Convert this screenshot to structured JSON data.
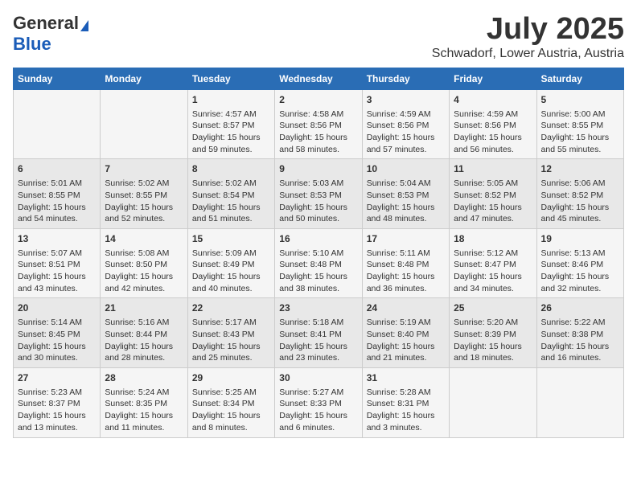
{
  "logo": {
    "general": "General",
    "blue": "Blue"
  },
  "title": {
    "month": "July 2025",
    "location": "Schwadorf, Lower Austria, Austria"
  },
  "weekdays": [
    "Sunday",
    "Monday",
    "Tuesday",
    "Wednesday",
    "Thursday",
    "Friday",
    "Saturday"
  ],
  "weeks": [
    [
      {
        "day": "",
        "info": ""
      },
      {
        "day": "",
        "info": ""
      },
      {
        "day": "1",
        "info": "Sunrise: 4:57 AM\nSunset: 8:57 PM\nDaylight: 15 hours\nand 59 minutes."
      },
      {
        "day": "2",
        "info": "Sunrise: 4:58 AM\nSunset: 8:56 PM\nDaylight: 15 hours\nand 58 minutes."
      },
      {
        "day": "3",
        "info": "Sunrise: 4:59 AM\nSunset: 8:56 PM\nDaylight: 15 hours\nand 57 minutes."
      },
      {
        "day": "4",
        "info": "Sunrise: 4:59 AM\nSunset: 8:56 PM\nDaylight: 15 hours\nand 56 minutes."
      },
      {
        "day": "5",
        "info": "Sunrise: 5:00 AM\nSunset: 8:55 PM\nDaylight: 15 hours\nand 55 minutes."
      }
    ],
    [
      {
        "day": "6",
        "info": "Sunrise: 5:01 AM\nSunset: 8:55 PM\nDaylight: 15 hours\nand 54 minutes."
      },
      {
        "day": "7",
        "info": "Sunrise: 5:02 AM\nSunset: 8:55 PM\nDaylight: 15 hours\nand 52 minutes."
      },
      {
        "day": "8",
        "info": "Sunrise: 5:02 AM\nSunset: 8:54 PM\nDaylight: 15 hours\nand 51 minutes."
      },
      {
        "day": "9",
        "info": "Sunrise: 5:03 AM\nSunset: 8:53 PM\nDaylight: 15 hours\nand 50 minutes."
      },
      {
        "day": "10",
        "info": "Sunrise: 5:04 AM\nSunset: 8:53 PM\nDaylight: 15 hours\nand 48 minutes."
      },
      {
        "day": "11",
        "info": "Sunrise: 5:05 AM\nSunset: 8:52 PM\nDaylight: 15 hours\nand 47 minutes."
      },
      {
        "day": "12",
        "info": "Sunrise: 5:06 AM\nSunset: 8:52 PM\nDaylight: 15 hours\nand 45 minutes."
      }
    ],
    [
      {
        "day": "13",
        "info": "Sunrise: 5:07 AM\nSunset: 8:51 PM\nDaylight: 15 hours\nand 43 minutes."
      },
      {
        "day": "14",
        "info": "Sunrise: 5:08 AM\nSunset: 8:50 PM\nDaylight: 15 hours\nand 42 minutes."
      },
      {
        "day": "15",
        "info": "Sunrise: 5:09 AM\nSunset: 8:49 PM\nDaylight: 15 hours\nand 40 minutes."
      },
      {
        "day": "16",
        "info": "Sunrise: 5:10 AM\nSunset: 8:48 PM\nDaylight: 15 hours\nand 38 minutes."
      },
      {
        "day": "17",
        "info": "Sunrise: 5:11 AM\nSunset: 8:48 PM\nDaylight: 15 hours\nand 36 minutes."
      },
      {
        "day": "18",
        "info": "Sunrise: 5:12 AM\nSunset: 8:47 PM\nDaylight: 15 hours\nand 34 minutes."
      },
      {
        "day": "19",
        "info": "Sunrise: 5:13 AM\nSunset: 8:46 PM\nDaylight: 15 hours\nand 32 minutes."
      }
    ],
    [
      {
        "day": "20",
        "info": "Sunrise: 5:14 AM\nSunset: 8:45 PM\nDaylight: 15 hours\nand 30 minutes."
      },
      {
        "day": "21",
        "info": "Sunrise: 5:16 AM\nSunset: 8:44 PM\nDaylight: 15 hours\nand 28 minutes."
      },
      {
        "day": "22",
        "info": "Sunrise: 5:17 AM\nSunset: 8:43 PM\nDaylight: 15 hours\nand 25 minutes."
      },
      {
        "day": "23",
        "info": "Sunrise: 5:18 AM\nSunset: 8:41 PM\nDaylight: 15 hours\nand 23 minutes."
      },
      {
        "day": "24",
        "info": "Sunrise: 5:19 AM\nSunset: 8:40 PM\nDaylight: 15 hours\nand 21 minutes."
      },
      {
        "day": "25",
        "info": "Sunrise: 5:20 AM\nSunset: 8:39 PM\nDaylight: 15 hours\nand 18 minutes."
      },
      {
        "day": "26",
        "info": "Sunrise: 5:22 AM\nSunset: 8:38 PM\nDaylight: 15 hours\nand 16 minutes."
      }
    ],
    [
      {
        "day": "27",
        "info": "Sunrise: 5:23 AM\nSunset: 8:37 PM\nDaylight: 15 hours\nand 13 minutes."
      },
      {
        "day": "28",
        "info": "Sunrise: 5:24 AM\nSunset: 8:35 PM\nDaylight: 15 hours\nand 11 minutes."
      },
      {
        "day": "29",
        "info": "Sunrise: 5:25 AM\nSunset: 8:34 PM\nDaylight: 15 hours\nand 8 minutes."
      },
      {
        "day": "30",
        "info": "Sunrise: 5:27 AM\nSunset: 8:33 PM\nDaylight: 15 hours\nand 6 minutes."
      },
      {
        "day": "31",
        "info": "Sunrise: 5:28 AM\nSunset: 8:31 PM\nDaylight: 15 hours\nand 3 minutes."
      },
      {
        "day": "",
        "info": ""
      },
      {
        "day": "",
        "info": ""
      }
    ]
  ]
}
